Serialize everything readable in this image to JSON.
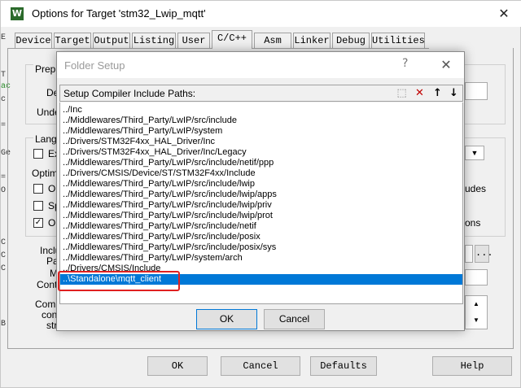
{
  "window": {
    "title": "Options for Target 'stm32_Lwip_mqtt'",
    "icon_letter": "W",
    "close_glyph": "✕"
  },
  "tabs": [
    "Device",
    "Target",
    "Output",
    "Listing",
    "User",
    "C/C++",
    "Asm",
    "Linker",
    "Debug",
    "Utilities"
  ],
  "active_tab": "C/C++",
  "background": {
    "prepro_label": "Prepro",
    "def_label": "Def",
    "undef_label": "Undef",
    "langu_label": "Langu",
    "ex_label": "Ex",
    "optimiz_label": "Optimiz",
    "op_label": "Op",
    "sp_label": "Sp",
    "on_label": "On",
    "udes_label": "udes",
    "ons_label": "ons",
    "inclu_label": "Inclu",
    "pat_label": "Pat",
    "m_label": "M",
    "contr_label": "Contr",
    "comp_label": "Comp",
    "cont_label": "cont",
    "str_label": "str",
    "browse_label": "...",
    "left_frags": [
      "E",
      "T",
      "ac",
      "c",
      "=",
      "Ge",
      "=",
      "O",
      "C",
      "C",
      "C",
      "B"
    ]
  },
  "buttons": {
    "ok": "OK",
    "cancel": "Cancel",
    "defaults": "Defaults",
    "help": "Help"
  },
  "folder_setup": {
    "title": "Folder Setup",
    "help_glyph": "?",
    "close_glyph": "✕",
    "header_label": "Setup Compiler Include Paths:",
    "toolbar": {
      "new_glyph": "⬚",
      "delete_glyph": "✕",
      "up_glyph": "↑",
      "down_glyph": "↓"
    },
    "paths": [
      "../Inc",
      "../Middlewares/Third_Party/LwIP/src/include",
      "../Middlewares/Third_Party/LwIP/system",
      "../Drivers/STM32F4xx_HAL_Driver/Inc",
      "../Drivers/STM32F4xx_HAL_Driver/Inc/Legacy",
      "../Middlewares/Third_Party/LwIP/src/include/netif/ppp",
      "../Drivers/CMSIS/Device/ST/STM32F4xx/Include",
      "../Middlewares/Third_Party/LwIP/src/include/lwip",
      "../Middlewares/Third_Party/LwIP/src/include/lwip/apps",
      "../Middlewares/Third_Party/LwIP/src/include/lwip/priv",
      "../Middlewares/Third_Party/LwIP/src/include/lwip/prot",
      "../Middlewares/Third_Party/LwIP/src/include/netif",
      "../Middlewares/Third_Party/LwIP/src/include/posix",
      "../Middlewares/Third_Party/LwIP/src/include/posix/sys",
      "../Middlewares/Third_Party/LwIP/system/arch",
      "../Drivers/CMSIS/Include",
      "..\\Standalone\\mqtt_client"
    ],
    "selected_index": 16,
    "ok": "OK",
    "cancel": "Cancel"
  },
  "colors": {
    "selection": "#0078d7",
    "highlight_box": "#e02020"
  }
}
